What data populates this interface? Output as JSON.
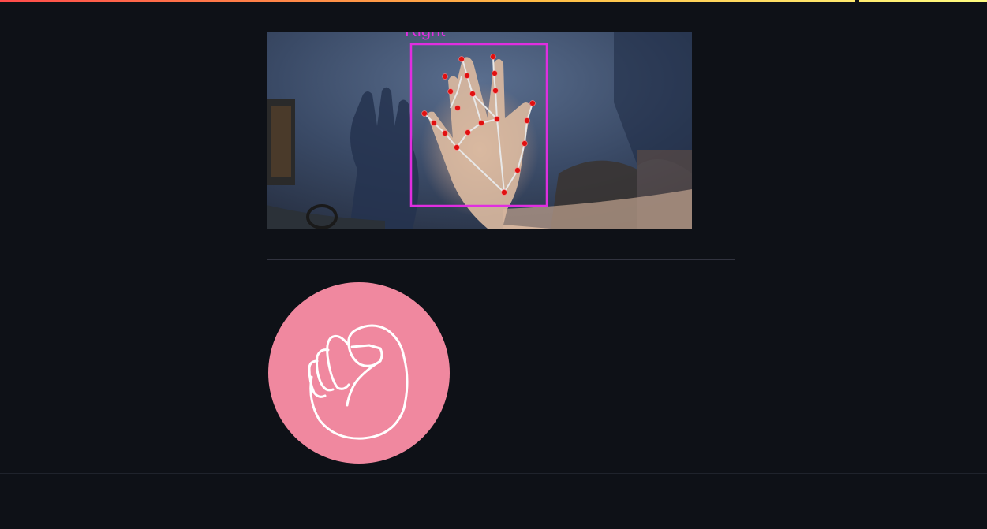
{
  "app": {
    "accent_gradient": [
      "#ff4b4b",
      "#ffbd45",
      "#fffd80"
    ],
    "background": "#0e1117"
  },
  "camera": {
    "detection_label": "Right",
    "box_color": "#e02ee0",
    "landmark_color": "#e01010",
    "connection_color": "#e8e8e8"
  },
  "gesture": {
    "icon": "fist-icon",
    "badge_color": "#f0889f"
  }
}
